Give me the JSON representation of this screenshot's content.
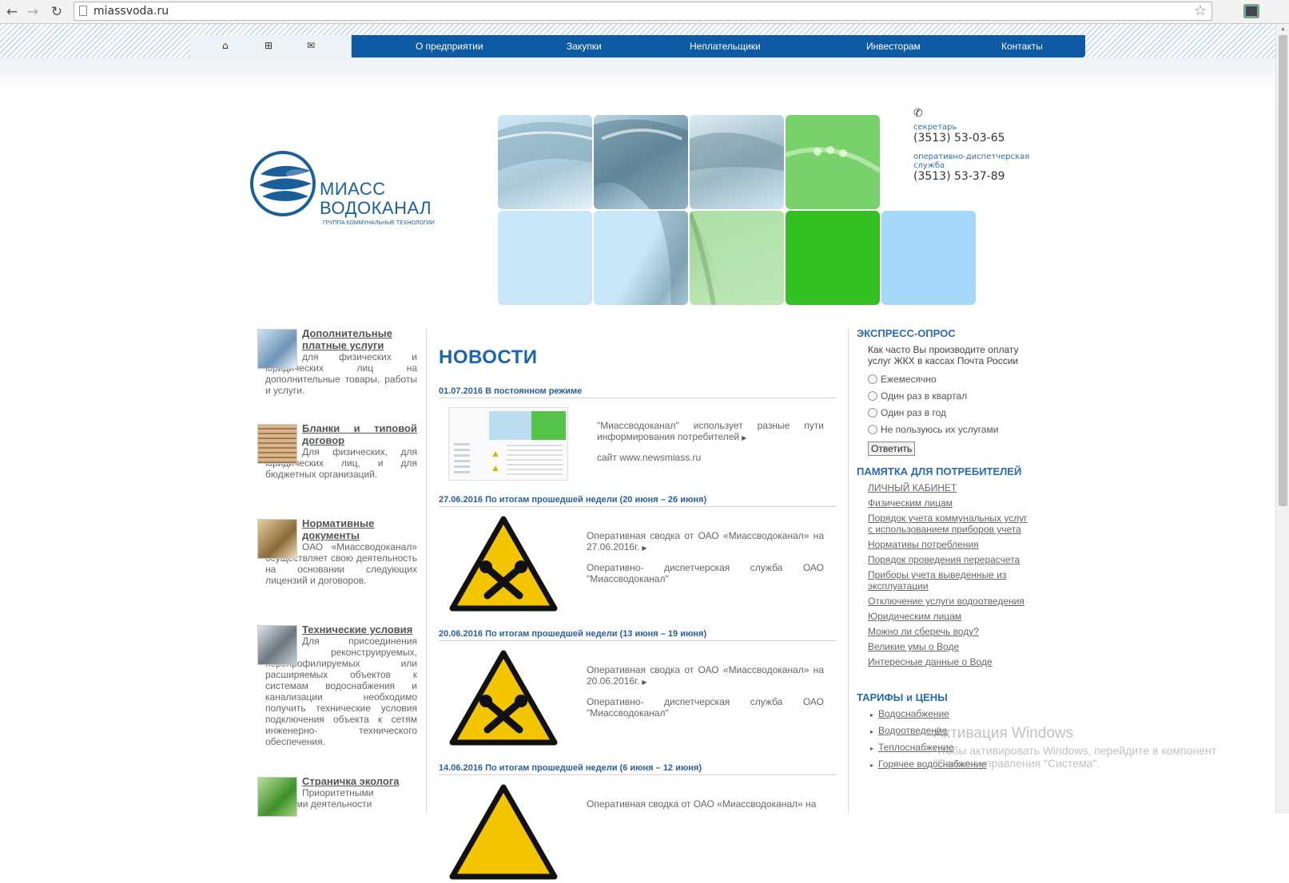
{
  "browser": {
    "url": "miassvoda.ru",
    "back_icon": "back-arrow-icon",
    "forward_icon": "forward-arrow-icon",
    "reload_icon": "reload-icon",
    "star_icon": "star-icon"
  },
  "quicknav": {
    "home_glyph": "⌂",
    "sitemap_glyph": "⊞",
    "mail_glyph": "✉"
  },
  "nav": [
    "О предприятии",
    "Закупки",
    "Неплательщики",
    "Инвесторам",
    "Контакты"
  ],
  "logo": {
    "line1": "МИАСС",
    "line2": "ВОДОКАНАЛ",
    "line3": "ГРУППА КОММУНАЛЬНЫЕ ТЕХНОЛОГИИ"
  },
  "contacts": {
    "secretary_label": "секретарь",
    "secretary_phone": "(3513) 53-03-65",
    "dispatch_label": "оперативно-диспетчерская служба",
    "dispatch_phone": "(3513) 53-37-89"
  },
  "left": [
    {
      "title": "Дополнительные платные услуги",
      "desc": "для физических и юридических лиц на дополнительные товары, работы и услуги."
    },
    {
      "title": "Бланки и типовой договор",
      "desc": "Для физических, для юридических лиц, и для бюджетных организаций."
    },
    {
      "title": "Нормативные документы",
      "desc": "ОАО «Миассводоканал» осуществляет свою деятельность на основании следующих лицензий и договоров."
    },
    {
      "title": "Технические условия",
      "desc": "Для присоединения новых, реконструируемых, перепрофилируемых или расширяемых объектов к системам водоснабжения и канализации необходимо получить технические условия подключения объекта к сетям инженерно- технического обеспечения."
    },
    {
      "title": "Страничка эколога",
      "desc": "Приоритетными задачами деятельности"
    }
  ],
  "news": {
    "title": "НОВОСТИ",
    "items": [
      {
        "head": "01.07.2016 В постоянном режиме",
        "p1": "\"Миассводоканал\" использует разные пути информирования потребителей",
        "p2": "сайт www.newsmiass.ru"
      },
      {
        "head": "27.06.2016 По итогам прошедшей недели (20 июня – 26 июня)",
        "p1": "Оперативная сводка от ОАО «Миассводоканал» на 27.06.2016г.",
        "p2": "Оперативно- диспетчерская служба ОАО \"Миассводоканал\""
      },
      {
        "head": "20.06.2016 По итогам прошедшей недели (13 июня – 19 июня)",
        "p1": "Оперативная сводка от ОАО «Миассводоканал» на 20.06.2016г.",
        "p2": "Оперативно- диспетчерская служба ОАО \"Миассводоканал\""
      },
      {
        "head": "14.06.2016 По итогам прошедшей недели (6 июня – 12 июня)",
        "p1": "Оперативная сводка от ОАО «Миассводоканал» на"
      }
    ]
  },
  "poll": {
    "title": "ЭКСПРЕСС-ОПРОС",
    "question": "Как часто Вы производите оплату услуг ЖКХ в кассах Почта России",
    "options": [
      "Ежемесячно",
      "Один раз в квартал",
      "Один раз в год",
      "Не пользуюсь их услугами"
    ],
    "submit": "Ответить"
  },
  "memo": {
    "title": "ПАМЯТКА ДЛЯ ПОТРЕБИТЕЛЕЙ",
    "links": [
      "ЛИЧНЫЙ КАБИНЕТ",
      "Физическим лицам",
      "Порядок учета коммунальных услуг с использованием приборов учета",
      "Нормативы потребления",
      "Порядок проведения перерасчета",
      "Приборы учета выведенные из эксплуатации",
      "Отключение услуги водоотведения",
      "Юридическим лицам",
      "Можно ли сберечь воду?",
      "Великие умы о Воде",
      "Интересные данные о Воде"
    ]
  },
  "tariffs": {
    "title": "ТАРИФЫ и ЦЕНЫ",
    "links": [
      "Водоснабжение",
      "Водоотведение",
      "Теплоснабжение",
      "Горячее водоснабжение"
    ]
  },
  "activation": {
    "line1": "Активация Windows",
    "line2": "Чтобы активировать Windows, перейдите в компонент",
    "line3": "\"Панели управления \"Система\"."
  },
  "colors": {
    "nav_bg": "#0d5aa2",
    "heading": "#1c66b0",
    "tile_green": "#32c022",
    "tile_blue": "#a6d8fa"
  }
}
